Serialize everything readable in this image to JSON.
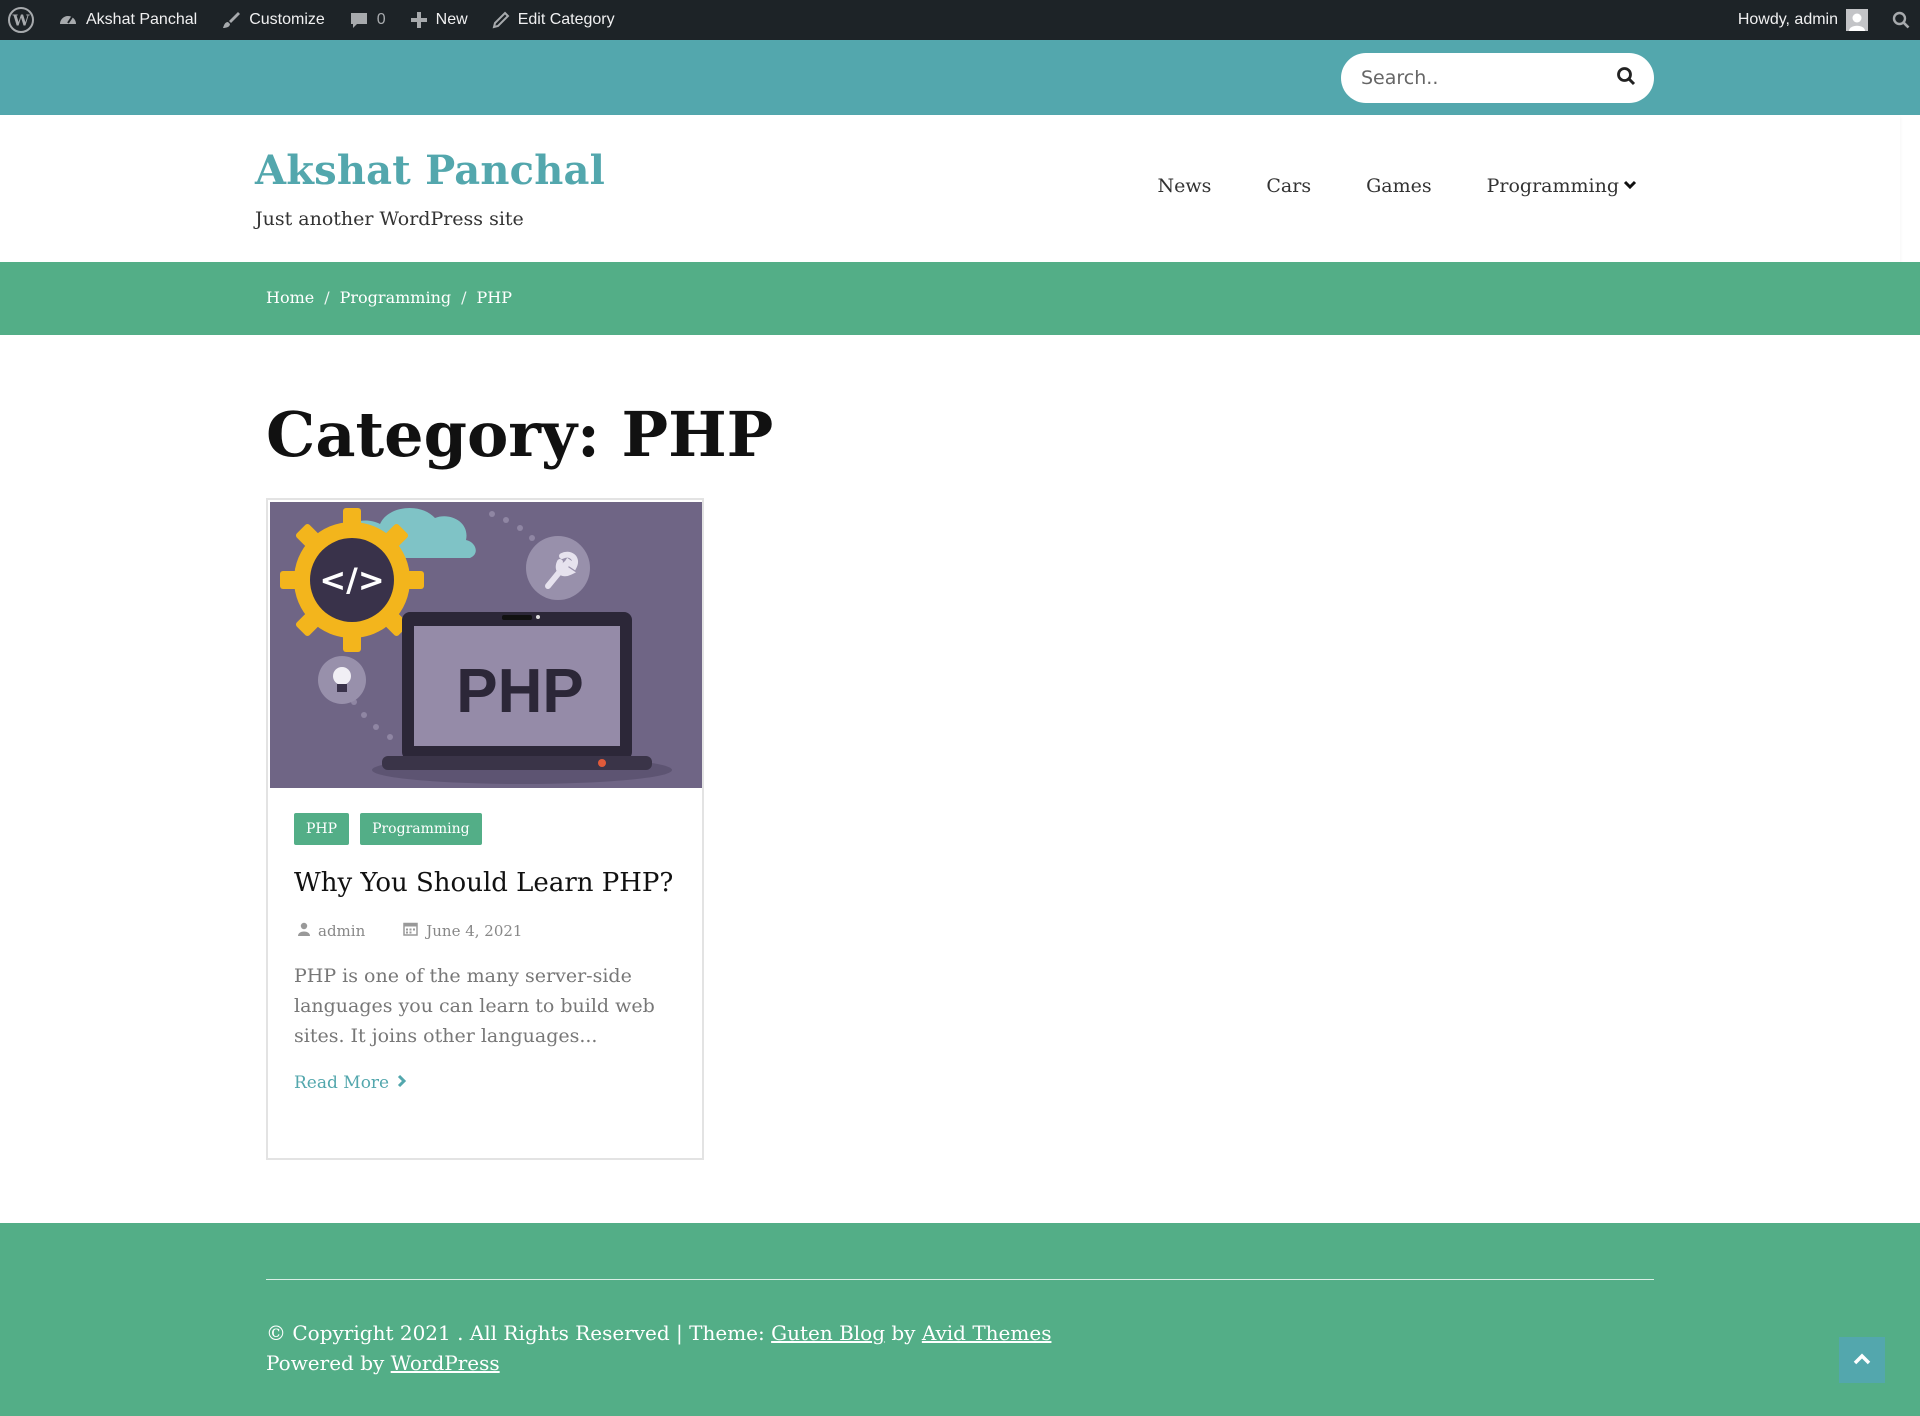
{
  "admin_bar": {
    "site_name": "Akshat Panchal",
    "customize": "Customize",
    "comments_count": "0",
    "new_label": "New",
    "edit_label": "Edit Category",
    "howdy": "Howdy, admin"
  },
  "search": {
    "placeholder": "Search.."
  },
  "header": {
    "site_title": "Akshat Panchal",
    "tagline": "Just another WordPress site",
    "nav": [
      "News",
      "Cars",
      "Games",
      "Programming"
    ]
  },
  "breadcrumb": {
    "items": [
      "Home",
      "Programming",
      "PHP"
    ],
    "separator": "/"
  },
  "main": {
    "title": "Category: PHP",
    "post": {
      "image_text": "PHP",
      "image_code_symbol": "</>",
      "tags": [
        "PHP",
        "Programming"
      ],
      "title": "Why You Should Learn PHP?",
      "author": "admin",
      "date": "June 4, 2021",
      "excerpt": "PHP is one of the many server-side languages you can learn to build web sites. It joins other languages...",
      "read_more": "Read More"
    }
  },
  "footer": {
    "copyright_prefix": "© Copyright 2021 . All Rights Reserved | Theme: ",
    "theme_link": "Guten Blog",
    "by": " by ",
    "author_link": "Avid Themes",
    "powered_prefix": "Powered by ",
    "powered_link": "WordPress"
  },
  "colors": {
    "admin_bar": "#1d2327",
    "top_band": "#53a7ad",
    "green": "#53ae87",
    "title_accent": "#53a7ad",
    "image_bg": "#6f6585"
  },
  "icons": [
    "wordpress-icon",
    "dashboard-icon",
    "brush-icon",
    "comment-icon",
    "plus-icon",
    "pencil-icon",
    "search-icon",
    "chevron-down-icon",
    "user-icon",
    "calendar-icon",
    "chevron-right-icon",
    "chevron-up-icon"
  ]
}
